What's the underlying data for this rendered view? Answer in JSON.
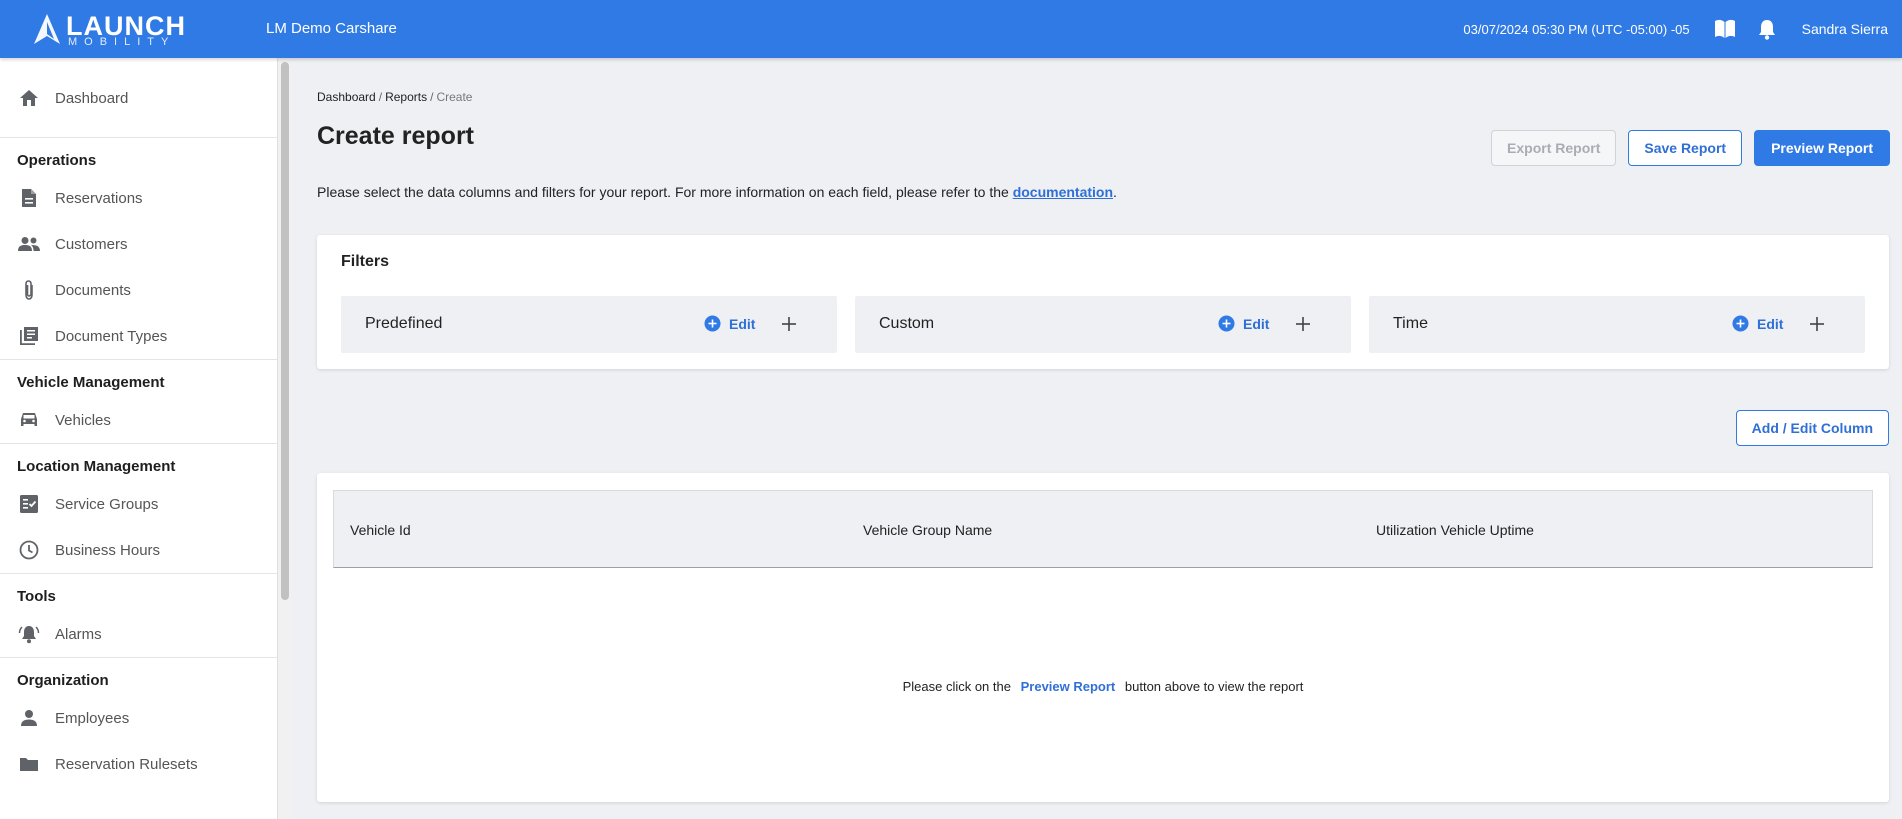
{
  "topbar": {
    "logo_word": "LAUNCH",
    "logo_sub": "MOBILITY",
    "org_name": "LM Demo Carshare",
    "datetime": "03/07/2024 05:30 PM (UTC -05:00) -05",
    "user_name": "Sandra Sierra"
  },
  "sidebar": {
    "dashboard": "Dashboard",
    "sections": [
      {
        "title": "Operations",
        "items": [
          "Reservations",
          "Customers",
          "Documents",
          "Document Types"
        ]
      },
      {
        "title": "Vehicle Management",
        "items": [
          "Vehicles"
        ]
      },
      {
        "title": "Location Management",
        "items": [
          "Service Groups",
          "Business Hours"
        ]
      },
      {
        "title": "Tools",
        "items": [
          "Alarms"
        ]
      },
      {
        "title": "Organization",
        "items": [
          "Employees",
          "Reservation Rulesets"
        ]
      }
    ]
  },
  "breadcrumb": [
    "Dashboard",
    "Reports",
    "Create"
  ],
  "page": {
    "title": "Create report",
    "description": "Please select the data columns and filters for your report. For more information on each field, please refer to the",
    "doc_link": "documentation",
    "desc_end": "."
  },
  "actions": {
    "export": "Export Report",
    "save": "Save Report",
    "preview": "Preview Report"
  },
  "filters": {
    "title": "Filters",
    "edit_label": "Edit",
    "boxes": [
      "Predefined",
      "Custom",
      "Time"
    ]
  },
  "add_column_label": "Add / Edit Column",
  "table": {
    "columns": [
      "Vehicle Id",
      "Vehicle Group Name",
      "Utilization Vehicle Uptime"
    ],
    "empty_before": "Please click on the",
    "empty_link": "Preview Report",
    "empty_after": "button above to view the report"
  }
}
